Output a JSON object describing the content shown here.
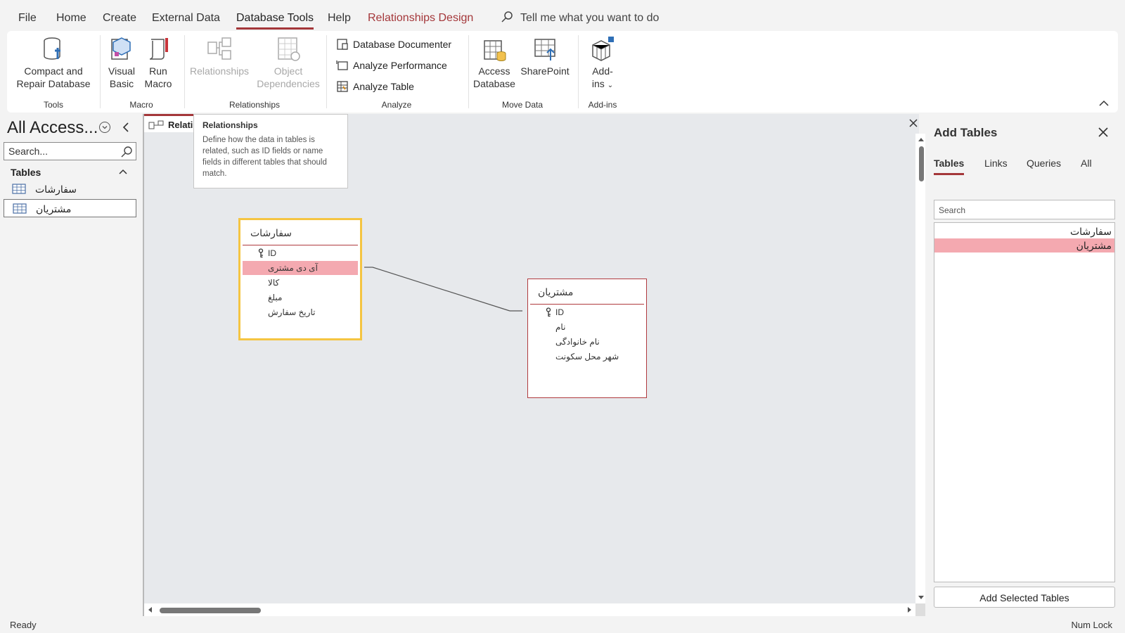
{
  "menu": {
    "items": [
      "File",
      "Home",
      "Create",
      "External Data",
      "Database Tools",
      "Help",
      "Relationships Design"
    ],
    "tell_me": "Tell me what you want to do"
  },
  "ribbon": {
    "tools": {
      "compact_line1": "Compact and",
      "compact_line2": "Repair Database",
      "label": "Tools"
    },
    "macro": {
      "vb_line1": "Visual",
      "vb_line2": "Basic",
      "run_line1": "Run",
      "run_line2": "Macro",
      "label": "Macro"
    },
    "relationships": {
      "rel": "Relationships",
      "dep_line1": "Object",
      "dep_line2": "Dependencies",
      "label": "Relationships"
    },
    "analyze": {
      "documenter": "Database Documenter",
      "performance": "Analyze Performance",
      "table": "Analyze Table",
      "label": "Analyze"
    },
    "move_data": {
      "access_line1": "Access",
      "access_line2": "Database",
      "sharepoint": "SharePoint",
      "label": "Move Data"
    },
    "addins": {
      "line1": "Add-",
      "line2": "ins",
      "label": "Add-ins"
    }
  },
  "nav": {
    "title": "All Access...",
    "search_placeholder": "Search...",
    "section": "Tables",
    "items": [
      "سفارشات",
      "مشتریان"
    ]
  },
  "doc": {
    "tab_label": "Relati",
    "tooltip": {
      "title": "Relationships",
      "body": "Define how the data in tables is related, such as ID fields or name fields in different tables that should match."
    },
    "tables": [
      {
        "name": "سفارشات",
        "fields": [
          "ID",
          "آی دی مشتری",
          "کالا",
          "مبلغ",
          "تاریخ سفارش"
        ],
        "highlighted_field": 1
      },
      {
        "name": "مشتریان",
        "fields": [
          "ID",
          "نام",
          "نام خانوادگی",
          "شهر محل سکونت"
        ]
      }
    ]
  },
  "add_tables": {
    "title": "Add Tables",
    "tabs": [
      "Tables",
      "Links",
      "Queries",
      "All"
    ],
    "active_tab": "Tables",
    "search_placeholder": "Search",
    "items": [
      "سفارشات",
      "مشتریان"
    ],
    "selected_item": "مشتریان",
    "button": "Add Selected Tables"
  },
  "status": {
    "left": "Ready",
    "right": "Num Lock"
  },
  "colors": {
    "accent": "#a4373a",
    "highlight": "#f4a9b0",
    "selection": "#f5c542"
  }
}
